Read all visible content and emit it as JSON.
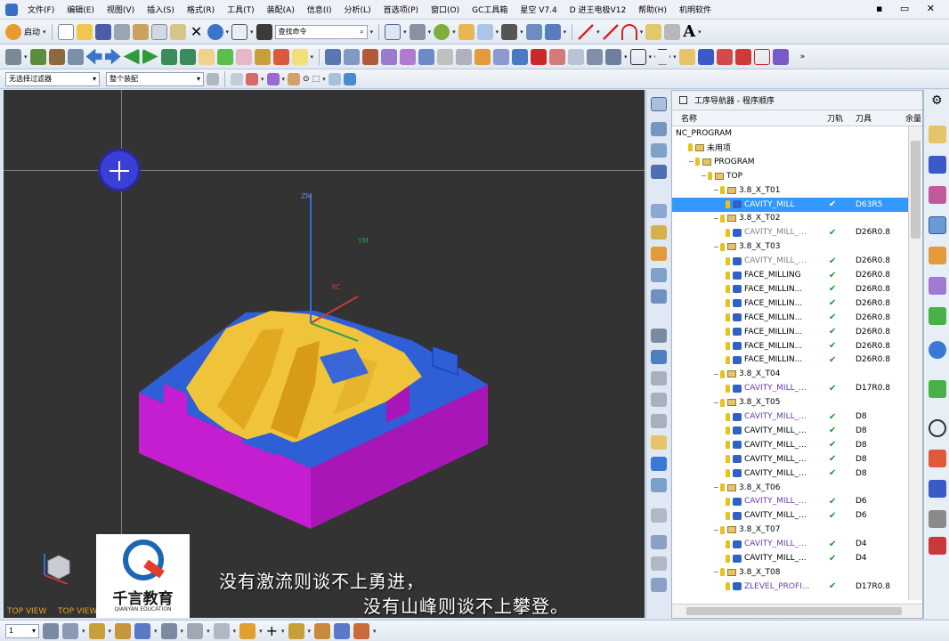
{
  "menu": [
    "文件(F)",
    "编辑(E)",
    "视图(V)",
    "插入(S)",
    "格式(R)",
    "工具(T)",
    "装配(A)",
    "信息(I)",
    "分析(L)",
    "首选项(P)",
    "窗口(O)",
    "GC工具箱",
    "星空 V7.4",
    "D 进王电极V12",
    "帮助(H)",
    "机明软件"
  ],
  "toolbar": {
    "start_label": "启动",
    "command_search": "查找命令",
    "filter_select": "无选择过滤器",
    "assembly_select": "整个装配"
  },
  "navigator": {
    "title": "工序导航器 - 程序顺序",
    "columns": {
      "name": "名称",
      "path": "刀轨",
      "tool": "刀具",
      "remain": "余量"
    },
    "rows": [
      {
        "indent": 0,
        "kind": "root",
        "name": "NC_PROGRAM"
      },
      {
        "indent": 1,
        "kind": "folder",
        "name": "未用项"
      },
      {
        "indent": 1,
        "kind": "folder",
        "name": "PROGRAM",
        "exp": "−"
      },
      {
        "indent": 2,
        "kind": "folder",
        "name": "TOP",
        "exp": "−"
      },
      {
        "indent": 3,
        "kind": "folder",
        "name": "3.8_X_T01",
        "exp": "−"
      },
      {
        "indent": 4,
        "kind": "op",
        "name": "CAVITY_MILL",
        "tool": "D63R5",
        "chk": "✔",
        "sel": true
      },
      {
        "indent": 3,
        "kind": "folder",
        "name": "3.8_X_T02",
        "exp": "−"
      },
      {
        "indent": 4,
        "kind": "op",
        "name": "CAVITY_MILL_...",
        "tool": "D26R0.8",
        "chk": "✔",
        "style": "gray"
      },
      {
        "indent": 3,
        "kind": "folder",
        "name": "3.8_X_T03",
        "exp": "−"
      },
      {
        "indent": 4,
        "kind": "op",
        "name": "CAVITY_MILL_...",
        "tool": "D26R0.8",
        "chk": "✔",
        "style": "gray"
      },
      {
        "indent": 4,
        "kind": "op",
        "name": "FACE_MILLING",
        "tool": "D26R0.8",
        "chk": "✔"
      },
      {
        "indent": 4,
        "kind": "op",
        "name": "FACE_MILLIN...",
        "tool": "D26R0.8",
        "chk": "✔"
      },
      {
        "indent": 4,
        "kind": "op",
        "name": "FACE_MILLIN...",
        "tool": "D26R0.8",
        "chk": "✔"
      },
      {
        "indent": 4,
        "kind": "op",
        "name": "FACE_MILLIN...",
        "tool": "D26R0.8",
        "chk": "✔"
      },
      {
        "indent": 4,
        "kind": "op",
        "name": "FACE_MILLIN...",
        "tool": "D26R0.8",
        "chk": "✔"
      },
      {
        "indent": 4,
        "kind": "op",
        "name": "FACE_MILLIN...",
        "tool": "D26R0.8",
        "chk": "✔"
      },
      {
        "indent": 4,
        "kind": "op",
        "name": "FACE_MILLIN...",
        "tool": "D26R0.8",
        "chk": "✔"
      },
      {
        "indent": 3,
        "kind": "folder",
        "name": "3.8_X_T04",
        "exp": "−"
      },
      {
        "indent": 4,
        "kind": "op",
        "name": "CAVITY_MILL_...",
        "tool": "D17R0.8",
        "chk": "✔",
        "style": "purple"
      },
      {
        "indent": 3,
        "kind": "folder",
        "name": "3.8_X_T05",
        "exp": "−"
      },
      {
        "indent": 4,
        "kind": "op",
        "name": "CAVITY_MILL_...",
        "tool": "D8",
        "chk": "✔",
        "style": "purple"
      },
      {
        "indent": 4,
        "kind": "op",
        "name": "CAVITY_MILL_...",
        "tool": "D8",
        "chk": "✔"
      },
      {
        "indent": 4,
        "kind": "op",
        "name": "CAVITY_MILL_...",
        "tool": "D8",
        "chk": "✔"
      },
      {
        "indent": 4,
        "kind": "op",
        "name": "CAVITY_MILL_...",
        "tool": "D8",
        "chk": "✔"
      },
      {
        "indent": 4,
        "kind": "op",
        "name": "CAVITY_MILL_...",
        "tool": "D8",
        "chk": "✔"
      },
      {
        "indent": 3,
        "kind": "folder",
        "name": "3.8_X_T06",
        "exp": "−"
      },
      {
        "indent": 4,
        "kind": "op",
        "name": "CAVITY_MILL_...",
        "tool": "D6",
        "chk": "✔",
        "style": "purple"
      },
      {
        "indent": 4,
        "kind": "op",
        "name": "CAVITY_MILL_...",
        "tool": "D6",
        "chk": "✔"
      },
      {
        "indent": 3,
        "kind": "folder",
        "name": "3.8_X_T07",
        "exp": "−"
      },
      {
        "indent": 4,
        "kind": "op",
        "name": "CAVITY_MILL_...",
        "tool": "D4",
        "chk": "✔",
        "style": "purple"
      },
      {
        "indent": 4,
        "kind": "op",
        "name": "CAVITY_MILL_...",
        "tool": "D4",
        "chk": "✔"
      },
      {
        "indent": 3,
        "kind": "folder",
        "name": "3.8_X_T08",
        "exp": "−"
      },
      {
        "indent": 4,
        "kind": "op",
        "name": "ZLEVEL_PROFI...",
        "tool": "D17R0.8",
        "chk": "✔",
        "style": "purple"
      }
    ]
  },
  "viewport": {
    "view_label_1": "TOP VIEW",
    "view_label_2": "TOP VIEW",
    "axis_zm": "ZM",
    "axis_xc": "XC",
    "axis_ym": "YM"
  },
  "logo": {
    "cn": "千言教育",
    "en": "QIANYAN EDUCATION"
  },
  "subtitle": {
    "line1": "没有激流则谈不上勇进，",
    "line2": "没有山峰则谈不上攀登。"
  },
  "bottom": {
    "layer_value": "1"
  },
  "colors": {
    "viewport_bg": "#333333",
    "part_side": "#c41ed0",
    "part_top": "#2f5fd6",
    "part_cavity": "#f0c43a",
    "selection": "#3399ff"
  }
}
